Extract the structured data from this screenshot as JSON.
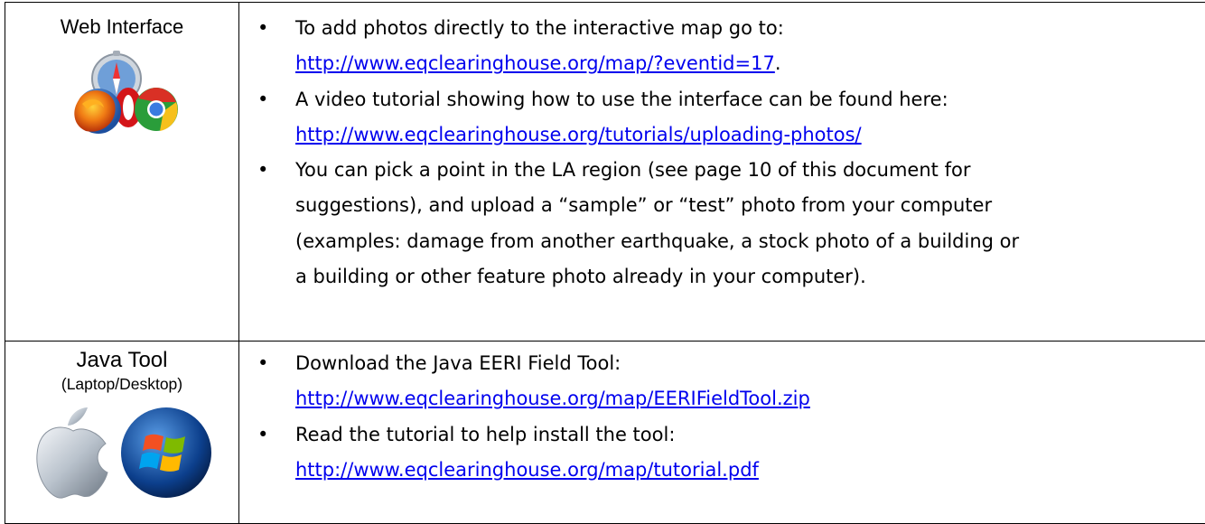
{
  "rows": [
    {
      "left_title": "Web Interface",
      "icons": [
        "safari-icon",
        "firefox-icon",
        "opera-icon",
        "chrome-icon"
      ],
      "bullets": [
        {
          "text": "To add photos directly to the interactive map go to:",
          "link": "http://www.eqclearinghouse.org/map/?eventid=17",
          "after": "."
        },
        {
          "text": "A video tutorial showing how to use the interface can be found here:",
          "link": "http://www.eqclearinghouse.org/tutorials/uploading-photos/",
          "after": ""
        },
        {
          "lines": [
            "You can pick a point in the LA region (see page 10 of this document for",
            "suggestions), and upload a “sample” or “test” photo from your computer",
            "(examples: damage from another earthquake, a stock photo of a building or",
            "a building or other feature photo already in your computer)."
          ]
        }
      ]
    },
    {
      "left_title": "Java Tool",
      "left_subtitle": "(Laptop/Desktop)",
      "icons": [
        "apple-icon",
        "windows-icon"
      ],
      "bullets": [
        {
          "text": "Download the Java EERI Field Tool:",
          "link": "http://www.eqclearinghouse.org/map/EERIFieldTool.zip",
          "after": ""
        },
        {
          "text": "Read the tutorial to help install the tool:",
          "link": "http://www.eqclearinghouse.org/map/tutorial.pdf",
          "after": ""
        }
      ]
    }
  ],
  "colors": {
    "link": "#0000ee",
    "border": "#000000"
  }
}
